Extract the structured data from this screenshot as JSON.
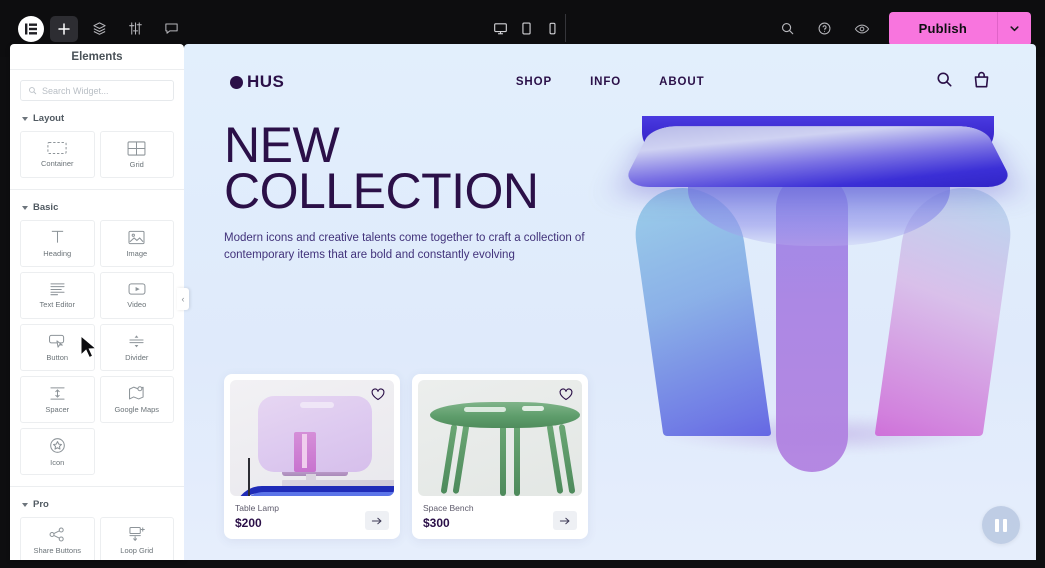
{
  "editor": {
    "logo_icon": "elementor-logo-icon",
    "toolbar_buttons": [
      {
        "name": "add-element-button",
        "icon": "plus-icon",
        "label": "+"
      },
      {
        "name": "structure-button",
        "icon": "layers-icon",
        "label": ""
      },
      {
        "name": "site-settings-button",
        "icon": "sliders-icon",
        "label": ""
      },
      {
        "name": "notes-button",
        "icon": "comment-icon",
        "label": ""
      }
    ],
    "responsive_modes": [
      {
        "name": "desktop-view-button",
        "icon": "desktop-icon",
        "selected": true
      },
      {
        "name": "tablet-view-button",
        "icon": "tablet-icon",
        "selected": false
      },
      {
        "name": "mobile-view-button",
        "icon": "mobile-icon",
        "selected": false
      }
    ],
    "right_icons": [
      {
        "name": "search-page-icon",
        "icon": "search-icon"
      },
      {
        "name": "help-icon",
        "icon": "question-circle-icon"
      },
      {
        "name": "preview-changes-icon",
        "icon": "eye-icon"
      }
    ],
    "publish_label": "Publish",
    "publish_caret_icon": "chevron-down-icon",
    "publish_color": "#f875de"
  },
  "panel": {
    "title": "Elements",
    "search_placeholder": "Search Widget...",
    "collapse_icon": "chevron-left-icon",
    "sections": [
      {
        "title": "Layout",
        "widgets": [
          {
            "label": "Container",
            "icon": "container-icon"
          },
          {
            "label": "Grid",
            "icon": "grid-icon"
          }
        ]
      },
      {
        "title": "Basic",
        "widgets": [
          {
            "label": "Heading",
            "icon": "heading-icon"
          },
          {
            "label": "Image",
            "icon": "image-icon"
          },
          {
            "label": "Text Editor",
            "icon": "text-editor-icon"
          },
          {
            "label": "Video",
            "icon": "video-icon"
          },
          {
            "label": "Button",
            "icon": "button-icon"
          },
          {
            "label": "Divider",
            "icon": "divider-icon"
          },
          {
            "label": "Spacer",
            "icon": "spacer-icon"
          },
          {
            "label": "Google Maps",
            "icon": "google-maps-icon"
          },
          {
            "label": "Icon",
            "icon": "star-icon"
          }
        ]
      },
      {
        "title": "Pro",
        "widgets": [
          {
            "label": "Share Buttons",
            "icon": "share-icon"
          },
          {
            "label": "Loop Grid",
            "icon": "loop-grid-icon"
          }
        ]
      }
    ]
  },
  "site": {
    "brand": "HUS",
    "brand_color": "#2b1048",
    "nav": [
      "SHOP",
      "INFO",
      "ABOUT"
    ],
    "header_icons": [
      {
        "name": "site-search-icon",
        "icon": "search-icon"
      },
      {
        "name": "site-cart-icon",
        "icon": "shopping-bag-icon"
      }
    ],
    "hero": {
      "line1": "NEW",
      "line2": "COLLECTION",
      "subtitle": "Modern icons and creative talents come together to craft a collection of contemporary items that are bold and constantly evolving"
    },
    "products": [
      {
        "name": "Table Lamp",
        "price": "$200",
        "wishlist_icon": "heart-icon",
        "cta_icon": "arrow-right-icon"
      },
      {
        "name": "Space Bench",
        "price": "$300",
        "wishlist_icon": "heart-icon",
        "cta_icon": "arrow-right-icon"
      }
    ],
    "pause_control": {
      "name": "pause-button",
      "icon": "pause-icon"
    }
  }
}
